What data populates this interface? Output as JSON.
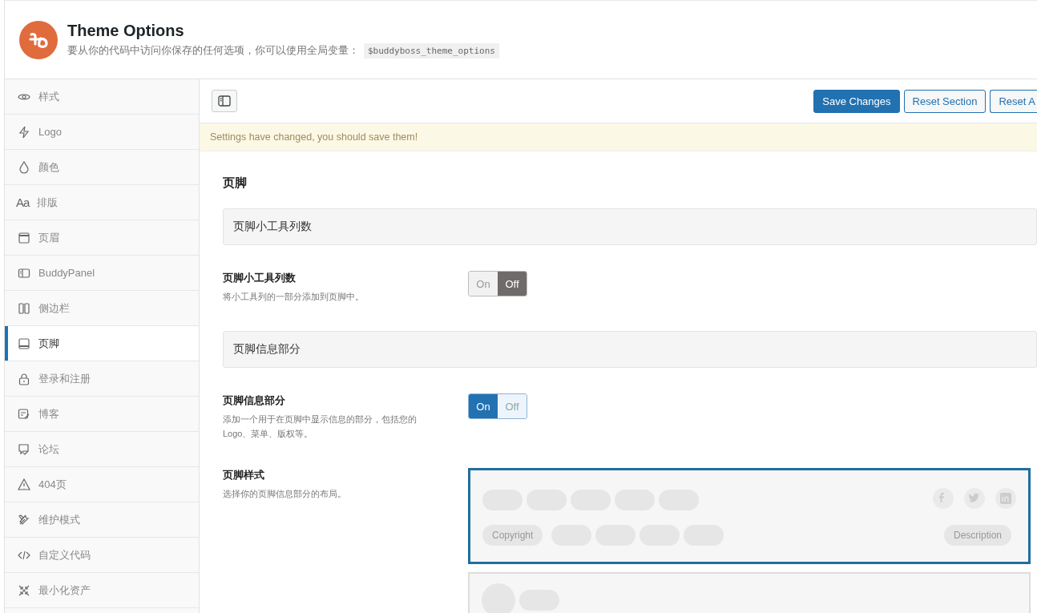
{
  "header": {
    "title": "Theme Options",
    "description": "要从你的代码中访问你保存的任何选项，你可以使用全局变量：",
    "code": "$buddyboss_theme_options"
  },
  "sidebar": {
    "items": [
      {
        "label": "样式",
        "selected": false
      },
      {
        "label": "Logo",
        "selected": false
      },
      {
        "label": "颜色",
        "selected": false
      },
      {
        "label": "排版",
        "selected": false,
        "icon": "Aa"
      },
      {
        "label": "页眉",
        "selected": false
      },
      {
        "label": "BuddyPanel",
        "selected": false
      },
      {
        "label": "侧边栏",
        "selected": false
      },
      {
        "label": "页脚",
        "selected": true
      },
      {
        "label": "登录和注册",
        "selected": false
      },
      {
        "label": "博客",
        "selected": false
      },
      {
        "label": "论坛",
        "selected": false
      },
      {
        "label": "404页",
        "selected": false
      },
      {
        "label": "维护模式",
        "selected": false
      },
      {
        "label": "自定义代码",
        "selected": false
      },
      {
        "label": "最小化资产",
        "selected": false
      }
    ]
  },
  "toolbar": {
    "buttons": [
      {
        "label": "Save Changes",
        "kind": "primary"
      },
      {
        "label": "Reset Section",
        "kind": "secondary"
      },
      {
        "label": "Reset A",
        "kind": "secondary"
      }
    ]
  },
  "notice": "Settings have changed, you should save them!",
  "section_title": "页脚",
  "fields": [
    {
      "kind": "heading",
      "label": "页脚小工具列数"
    },
    {
      "kind": "switch",
      "label": "页脚小工具列数",
      "description": "将小工具列的一部分添加到页脚中。",
      "on": false,
      "on_label": "On",
      "off_label": "Off"
    },
    {
      "kind": "heading",
      "label": "页脚信息部分"
    },
    {
      "kind": "switch",
      "label": "页脚信息部分",
      "description": "添加一个用于在页脚中显示信息的部分，包括您的Logo、菜单、版权等。",
      "on": true,
      "on_label": "On",
      "off_label": "Off"
    },
    {
      "kind": "layouts",
      "label": "页脚样式",
      "description": "选择你的页脚信息部分的布局。",
      "options": [
        {
          "selected": true,
          "copyright": "Copyright",
          "description": "Description"
        },
        {
          "selected": false
        }
      ]
    }
  ]
}
